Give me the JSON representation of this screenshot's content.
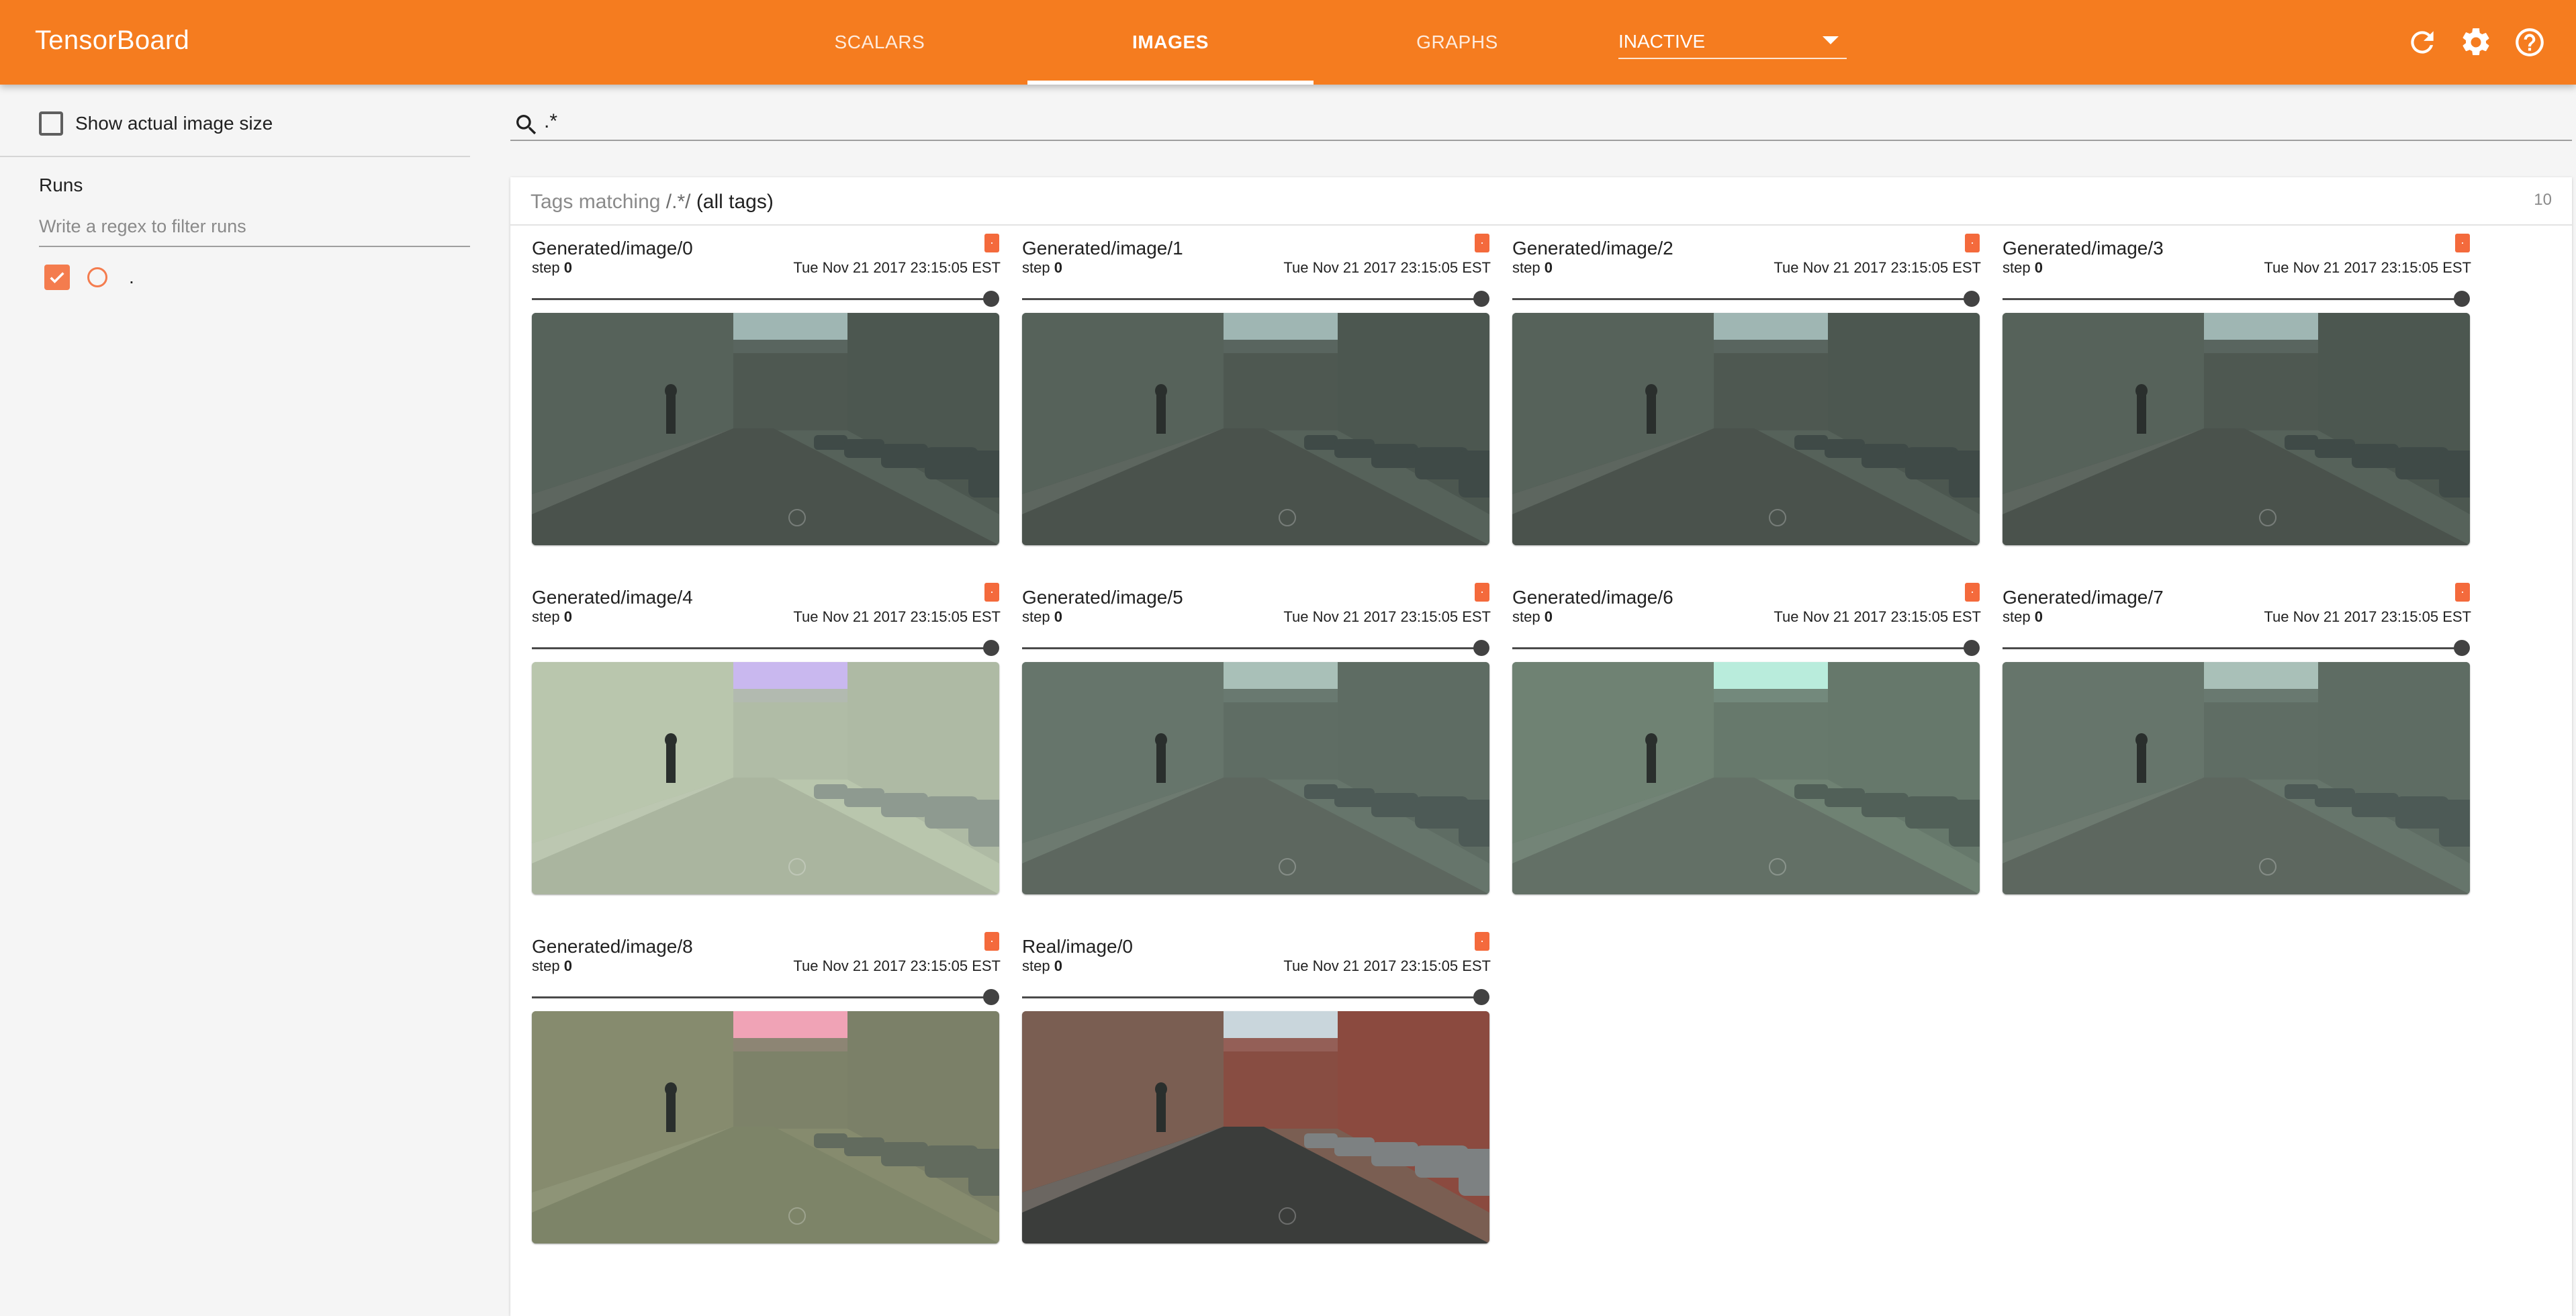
{
  "app": {
    "title": "TensorBoard"
  },
  "nav": {
    "tabs": [
      {
        "label": "SCALARS"
      },
      {
        "label": "IMAGES"
      },
      {
        "label": "GRAPHS"
      }
    ],
    "inactive_select": {
      "value": "INACTIVE"
    },
    "icons": [
      "reload-icon",
      "settings-icon",
      "help-icon"
    ]
  },
  "sidebar": {
    "show_actual_size_label": "Show actual image size",
    "runs_title": "Runs",
    "runs_filter_placeholder": "Write a regex to filter runs",
    "runs": [
      {
        "name": "."
      }
    ]
  },
  "search": {
    "value": ".*"
  },
  "card": {
    "tags_prefix": "Tags matching",
    "tags_regex": "/.*/",
    "tags_suffix": "(all tags)",
    "count": "10"
  },
  "images": [
    {
      "tag": "Generated/image/0",
      "step_label": "step",
      "step": "0",
      "time": "Tue Nov 21 2017 23:15:05 EST",
      "badge": ".",
      "variant": "dark"
    },
    {
      "tag": "Generated/image/1",
      "step_label": "step",
      "step": "0",
      "time": "Tue Nov 21 2017 23:15:05 EST",
      "badge": ".",
      "variant": "dark"
    },
    {
      "tag": "Generated/image/2",
      "step_label": "step",
      "step": "0",
      "time": "Tue Nov 21 2017 23:15:05 EST",
      "badge": ".",
      "variant": "dark"
    },
    {
      "tag": "Generated/image/3",
      "step_label": "step",
      "step": "0",
      "time": "Tue Nov 21 2017 23:15:05 EST",
      "badge": ".",
      "variant": "dark"
    },
    {
      "tag": "Generated/image/4",
      "step_label": "step",
      "step": "0",
      "time": "Tue Nov 21 2017 23:15:05 EST",
      "badge": ".",
      "variant": "light"
    },
    {
      "tag": "Generated/image/5",
      "step_label": "step",
      "step": "0",
      "time": "Tue Nov 21 2017 23:15:05 EST",
      "badge": ".",
      "variant": "mid"
    },
    {
      "tag": "Generated/image/6",
      "step_label": "step",
      "step": "0",
      "time": "Tue Nov 21 2017 23:15:05 EST",
      "badge": ".",
      "variant": "mint"
    },
    {
      "tag": "Generated/image/7",
      "step_label": "step",
      "step": "0",
      "time": "Tue Nov 21 2017 23:15:05 EST",
      "badge": ".",
      "variant": "mid"
    },
    {
      "tag": "Generated/image/8",
      "step_label": "step",
      "step": "0",
      "time": "Tue Nov 21 2017 23:15:05 EST",
      "badge": ".",
      "variant": "pink"
    },
    {
      "tag": "Real/image/0",
      "step_label": "step",
      "step": "0",
      "time": "Tue Nov 21 2017 23:15:05 EST",
      "badge": ".",
      "variant": "real"
    }
  ],
  "colors": {
    "accent": "#f57c1f",
    "run_color": "#f47c4e",
    "badge": "#f46a3c"
  }
}
